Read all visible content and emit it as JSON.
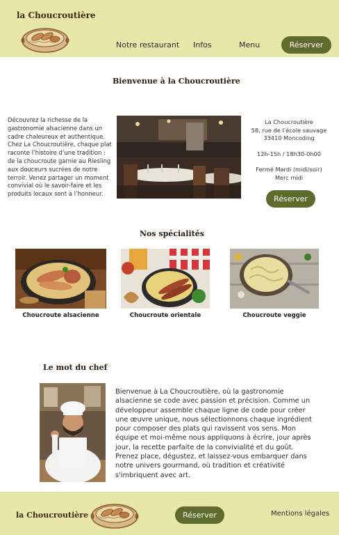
{
  "header": {
    "brand": "la Choucroutière",
    "nav": [
      {
        "label": "Notre restaurant"
      },
      {
        "label": "Infos"
      },
      {
        "label": "Menu"
      }
    ],
    "reserve_label": "Réserver"
  },
  "welcome": {
    "title": "Bienvenue à la Choucroutière",
    "intro": "Découvrez la richesse de la gastronomie alsacienne dans un cadre chaleureux et authentique. Chez La Choucroutière, chaque plat raconte l’histoire d’une tradition : de la choucroute garnie au Riesling aux douceurs sucrées de notre terroir. Venez partager un moment convivial où le savoir-faire et les produits locaux sont à l’honneur.",
    "info": {
      "name": "La Choucroutière",
      "address_line1": "58, rue de l’école sauvage",
      "address_line2": "33410 Moncoding",
      "hours": "12h-15h / 18h30-0h00",
      "closed_line1": "Fermé Mardi (midi/soir)",
      "closed_line2": "Merc midi"
    },
    "reserve_label": "Réserver"
  },
  "specialties": {
    "title": "Nos spécialités",
    "items": [
      {
        "label": "Choucroute alsacienne"
      },
      {
        "label": "Choucroute orientale"
      },
      {
        "label": "Choucroute veggie"
      }
    ]
  },
  "chef": {
    "title": "Le mot du chef",
    "text": "Bienvenue à La Choucroutière, où la gastronomie alsacienne se code avec passion et précision. Comme un développeur assemble chaque ligne de code pour créer une œuvre unique, nous sélectionnons chaque ingrédient pour composer des plats qui ravissent vos sens. Mon équipe et moi-même nous appliquons à écrire, jour après jour, la recette parfaite de la convivialité et du goût. Prenez place, dégustez, et laissez-vous embarquer dans notre univers gourmand, où tradition et créativité s'imbriquent avec art."
  },
  "footer": {
    "brand": "la Choucroutière",
    "reserve_label": "Réserver",
    "legal_label": "Mentions légales"
  },
  "colors": {
    "band": "#e6e7a9",
    "button": "#5f6b2d",
    "button_text": "#ffffff"
  },
  "icons": {
    "logo": "choucroute-dish-logo"
  }
}
